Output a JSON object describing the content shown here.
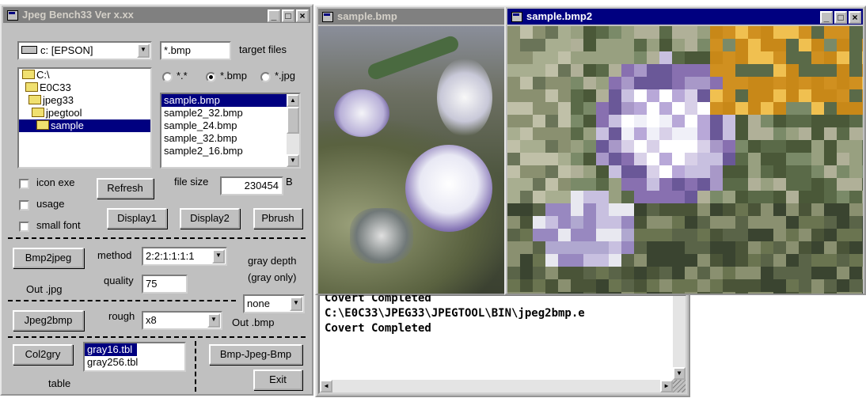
{
  "main_window": {
    "title": "Jpeg Bench33 Ver x.xx",
    "drive": "c: [EPSON]",
    "target_files_label": "target files",
    "filter_input": "*.bmp",
    "radio_options": [
      {
        "label": "*.*",
        "selected": false
      },
      {
        "label": "*.bmp",
        "selected": true
      },
      {
        "label": "*.jpg",
        "selected": false
      }
    ],
    "folders": [
      {
        "label": "C:\\",
        "selected": false
      },
      {
        "label": "E0C33",
        "selected": false
      },
      {
        "label": "jpeg33",
        "selected": false
      },
      {
        "label": "jpegtool",
        "selected": false
      },
      {
        "label": "sample",
        "selected": true
      }
    ],
    "files": [
      "sample.bmp",
      "sample2_32.bmp",
      "sample_24.bmp",
      "sample_32.bmp",
      "sample2_16.bmp"
    ],
    "selected_file": "sample.bmp",
    "icon_exe_label": "icon exe",
    "usage_label": "usage",
    "small_font_label": "small font",
    "refresh_label": "Refresh",
    "file_size_label": "file size",
    "file_size_value": "230454",
    "file_size_unit": "B",
    "display1_label": "Display1",
    "display2_label": "Display2",
    "pbrush_label": "Pbrush",
    "bmp2jpeg_label": "Bmp2jpeg",
    "method_label": "method",
    "method_value": "2:2:1:1:1:1",
    "gray_depth_label": "gray depth",
    "gray_only_label": "(gray only)",
    "out_jpg_label": "Out .jpg",
    "quality_label": "quality",
    "quality_value": "75",
    "gray_depth_value": "none",
    "jpeg2bmp_label": "Jpeg2bmp",
    "rough_label": "rough",
    "rough_value": "x8",
    "out_bmp_label": "Out .bmp",
    "col2gry_label": "Col2gry",
    "tables": [
      "gray16.tbl",
      "gray256.tbl"
    ],
    "selected_table": "gray16.tbl",
    "table_label": "table",
    "bmp_jpeg_bmp_label": "Bmp-Jpeg-Bmp",
    "exit_label": "Exit"
  },
  "image_window_1": {
    "title": "sample.bmp"
  },
  "image_window_2": {
    "title": "sample.bmp2"
  },
  "console": {
    "lines": [
      "Covert Completed",
      "C:\\E0C33\\JPEG33\\JPEGTOOL\\BIN\\jpeg2bmp.e",
      "Covert Completed"
    ]
  },
  "colors": {
    "active_title": "#000080",
    "inactive_title": "#808080",
    "face": "#c0c0c0"
  }
}
